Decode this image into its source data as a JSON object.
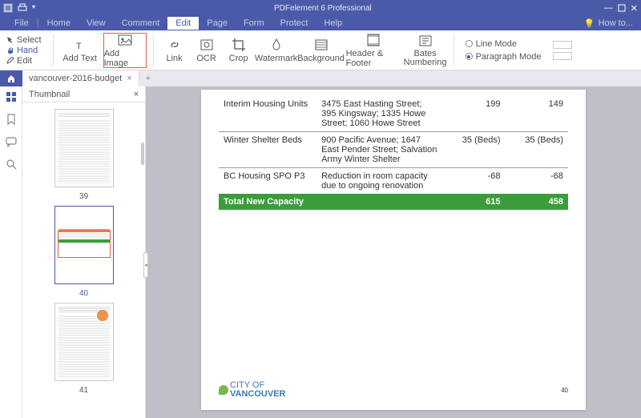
{
  "titlebar": {
    "app_title": "PDFelement 6 Professional"
  },
  "menu": {
    "file": "File",
    "home": "Home",
    "view": "View",
    "comment": "Comment",
    "edit": "Edit",
    "page": "Page",
    "form": "Form",
    "protect": "Protect",
    "help": "Help",
    "howto": "How to..."
  },
  "tools": {
    "select": "Select",
    "hand": "Hand",
    "edit": "Edit"
  },
  "ribbon": {
    "add_text": "Add Text",
    "add_image": "Add Image",
    "link": "Link",
    "ocr": "OCR",
    "crop": "Crop",
    "watermark": "Watermark",
    "background": "Background",
    "header_footer": "Header & Footer",
    "bates": "Bates\nNumbering",
    "line_mode": "Line Mode",
    "paragraph_mode": "Paragraph Mode"
  },
  "tabbar": {
    "doc": "vancouver-2016-budget",
    "close": "×",
    "add": "+"
  },
  "panel": {
    "title": "Thumbnail",
    "close": "×"
  },
  "thumbs": {
    "p39": "39",
    "p40": "40",
    "p41": "41"
  },
  "table_rows": [
    {
      "c1": "Interim Housing Units",
      "c2": "3475 East Hasting Street; 395 Kingsway; 1335 Howe Street; 1060 Howe Street",
      "c3": "199",
      "c4": "149"
    },
    {
      "c1": "Winter Shelter Beds",
      "c2": "900 Pacific Avenue; 1647 East Pender Street; Salvation Army Winter Shelter",
      "c3": "35 (Beds)",
      "c4": "35 (Beds)"
    },
    {
      "c1": "BC Housing SPO P3",
      "c2": "Reduction in room capacity due to ongoing renovation",
      "c3": "-68",
      "c4": "-68"
    }
  ],
  "total": {
    "label": "Total New Capacity",
    "c3": "615",
    "c4": "458"
  },
  "footer_logo": {
    "line1": "CITY OF",
    "line2": "VANCOUVER"
  },
  "page_num": "40"
}
